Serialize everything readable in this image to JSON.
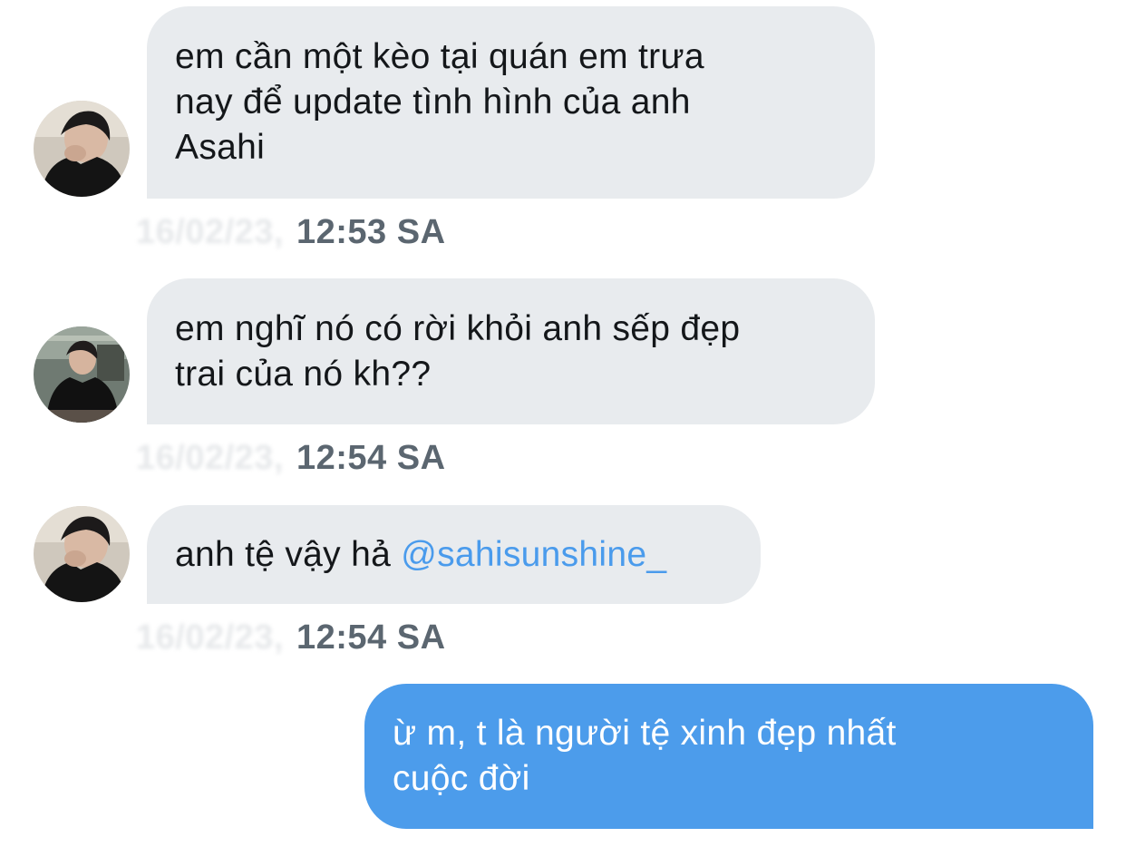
{
  "conversation": {
    "messages": [
      {
        "direction": "incoming",
        "avatar": "avatar-hoodie",
        "lines": [
          "em cần một kèo tại quán em trưa",
          "nay để update tình hình của anh",
          "Asahi"
        ],
        "date": "16/02/23,",
        "time": "12:53 SA"
      },
      {
        "direction": "incoming",
        "avatar": "avatar-black-tee",
        "lines": [
          "em nghĩ nó có rời khỏi anh sếp đẹp",
          "trai của nó kh??"
        ],
        "date": "16/02/23,",
        "time": "12:54 SA"
      },
      {
        "direction": "incoming",
        "avatar": "avatar-hoodie",
        "text": "anh tệ vậy hả ",
        "mention": "@sahisunshine_",
        "date": "16/02/23,",
        "time": "12:54 SA"
      },
      {
        "direction": "outgoing",
        "lines": [
          "ừ m, t là người tệ xinh đẹp nhất",
          "cuộc đời"
        ]
      }
    ]
  },
  "colors": {
    "incoming_bubble": "#e8ebee",
    "outgoing_bubble": "#4c9ceb",
    "mention": "#4a9bec",
    "timestamp": "#5b6670"
  }
}
